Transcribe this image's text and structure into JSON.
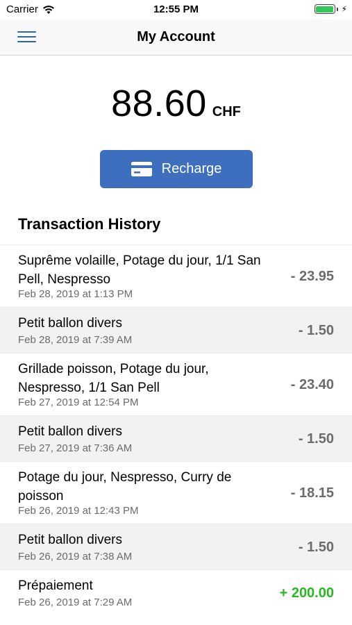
{
  "status_bar": {
    "carrier": "Carrier",
    "time": "12:55 PM",
    "battery_level": 1.0,
    "battery_color": "#34c759"
  },
  "nav": {
    "title": "My Account",
    "menu_icon": "hamburger-menu-icon"
  },
  "balance": {
    "amount": "88.60",
    "currency": "CHF"
  },
  "recharge": {
    "label": "Recharge",
    "icon": "credit-card-icon",
    "color": "#3d6fbe"
  },
  "history": {
    "title": "Transaction History",
    "transactions": [
      {
        "description": "Suprême volaille, Potage du jour, 1/1 San Pell, Nespresso",
        "date": "Feb 28, 2019 at 1:13 PM",
        "amount": "- 23.95"
      },
      {
        "description": "Petit ballon divers",
        "date": "Feb 28, 2019 at 7:39 AM",
        "amount": "- 1.50"
      },
      {
        "description": "Grillade poisson, Potage du jour, Nespresso, 1/1 San Pell",
        "date": "Feb 27, 2019 at 12:54 PM",
        "amount": "- 23.40"
      },
      {
        "description": "Petit ballon divers",
        "date": "Feb 27, 2019 at 7:36 AM",
        "amount": "- 1.50"
      },
      {
        "description": "Potage du jour, Nespresso, Curry de poisson",
        "date": "Feb 26, 2019 at 12:43 PM",
        "amount": "- 18.15"
      },
      {
        "description": "Petit ballon divers",
        "date": "Feb 26, 2019 at 7:38 AM",
        "amount": "- 1.50"
      },
      {
        "description": "Prépaiement",
        "date": "Feb 26, 2019 at 7:29 AM",
        "amount": "+ 200.00"
      }
    ],
    "debit_color": "#6b6b6b",
    "credit_color": "#28b823"
  }
}
